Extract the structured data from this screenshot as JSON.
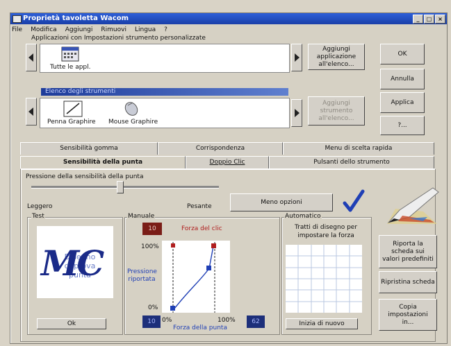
{
  "window": {
    "title": "Proprietà tavoletta Wacom"
  },
  "menu": [
    "File",
    "Modifica",
    "Aggiungi",
    "Rimuovi",
    "Lingua",
    "?"
  ],
  "applications": {
    "label": "Applicazioni con Impostazioni strumento personalizzate",
    "items": [
      "Tutte le appl."
    ],
    "add_button": "Aggiungi applicazione all'elenco..."
  },
  "tools": {
    "label": "Elenco degli strumenti",
    "items": [
      "Penna Graphire",
      "Mouse Graphire"
    ],
    "add_button": "Aggiungi strumento all'elenco..."
  },
  "buttons": {
    "ok": "OK",
    "cancel": "Annulla",
    "apply": "Applica",
    "help": "?..."
  },
  "tabs_back": [
    "Sensibilità gomma",
    "Corrispondenza",
    "Menu di scelta rapida"
  ],
  "tabs_front": [
    "Sensibilità della punta",
    "Doppio Clic",
    "Pulsanti dello strumento"
  ],
  "pressure": {
    "group_label": "Pressione della sensibilità della punta",
    "light": "Leggero",
    "heavy": "Pesante",
    "slider_level": 0.47,
    "less_options": "Meno opzioni"
  },
  "test": {
    "label": "Test",
    "ok": "Ok",
    "sample_text": "Disegno di prova punta",
    "monogram": "MC"
  },
  "manual": {
    "label": "Manuale",
    "click_value": "10",
    "click_force_label": "Forza del clic",
    "y_top": "100%",
    "y_bottom": "0%",
    "y_label": "Pressione riportata",
    "x_left": "0%",
    "x_right": "100%",
    "x_label": "Forza della punta",
    "min_value": "10",
    "max_value": "62"
  },
  "automatic": {
    "label": "Automatico",
    "description": "Tratti di disegno per impostare la forza",
    "restart": "Inizia di nuovo"
  },
  "side_buttons": [
    "Riporta la scheda sui valori predefiniti",
    "Ripristina scheda",
    "Copia impostazioni in..."
  ],
  "colors": {
    "title": "#1a3fa8",
    "accent_red": "#b01e1e",
    "value_box": "#1d2f7a",
    "check": "#1f3fb5"
  }
}
